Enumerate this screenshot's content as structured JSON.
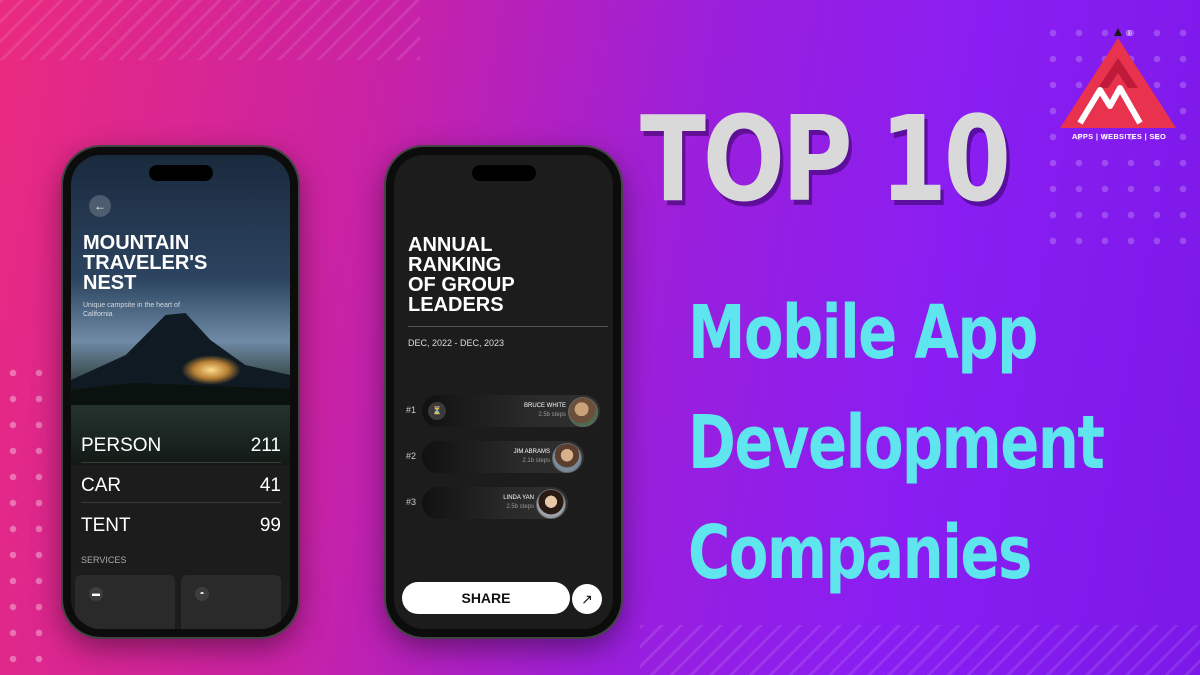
{
  "headline": {
    "top": "TOP 10",
    "lines": [
      "Mobile App",
      "Development",
      "Companies"
    ]
  },
  "logo": {
    "tagline": "APPS | WEBSITES | SEO",
    "mark": "®"
  },
  "phone1": {
    "title": "MOUNTAIN\nTRAVELER'S\nNEST",
    "subtitle": "Unique campsite in the heart of California",
    "stats": [
      {
        "label": "PERSON",
        "value": "211"
      },
      {
        "label": "CAR",
        "value": "41"
      },
      {
        "label": "TENT",
        "value": "99"
      }
    ],
    "services_label": "SERVICES",
    "back_icon": "arrow-left-icon",
    "service_icons": [
      "car-icon",
      "cloche-icon"
    ]
  },
  "phone2": {
    "title": "ANNUAL\nRANKING\nOF GROUP\nLEADERS",
    "date_range": "DEC, 2022 - DEC, 2023",
    "ranks": [
      {
        "rank": "#1",
        "name": "BRUCE WHITE",
        "steps": "2.5b steps"
      },
      {
        "rank": "#2",
        "name": "JIM ABRAMS",
        "steps": "2.1b steps"
      },
      {
        "rank": "#3",
        "name": "LINDA YAN",
        "steps": "2.5b steps"
      }
    ],
    "share_label": "SHARE",
    "trophy_icon": "trophy-icon",
    "arrow_icon": "arrow-up-right-icon"
  },
  "colors": {
    "headline_primary": "#d9d9d9",
    "headline_accent": "#5ee5ee",
    "bg_left": "#ea2a7f",
    "bg_right": "#7b18e8",
    "logo_red": "#e8324e"
  }
}
